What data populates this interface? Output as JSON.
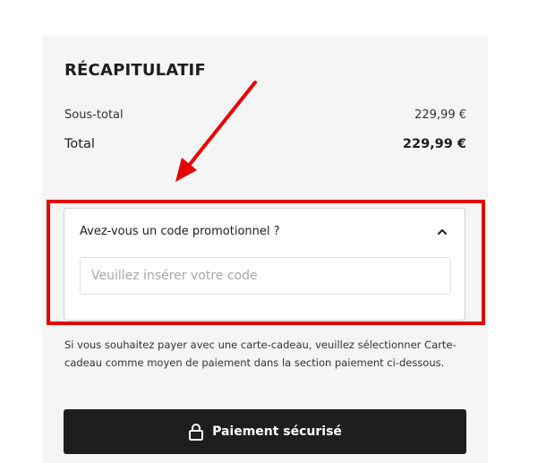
{
  "summary": {
    "title": "RÉCAPITULATIF",
    "subtotal_label": "Sous-total",
    "subtotal_value": "229,99 €",
    "total_label": "Total",
    "total_value": "229,99 €"
  },
  "promo": {
    "question": "Avez-vous un code promotionnel ?",
    "placeholder": "Veuillez insérer votre code",
    "value": "",
    "expanded": true
  },
  "gift_card_note": "Si vous souhaitez payer avec une carte-cadeau, veuillez sélectionner Carte-cadeau comme moyen de paiement dans la section paiement ci-dessous.",
  "checkout": {
    "button_label": "Paiement sécurisé",
    "icon": "lock-icon"
  },
  "annotation": {
    "color": "#e60000",
    "arrow_icon": "arrow-icon"
  },
  "colors": {
    "panel_bg": "#f5f5f5",
    "button_bg": "#1e1e1e",
    "text": "#1e1e1e"
  }
}
